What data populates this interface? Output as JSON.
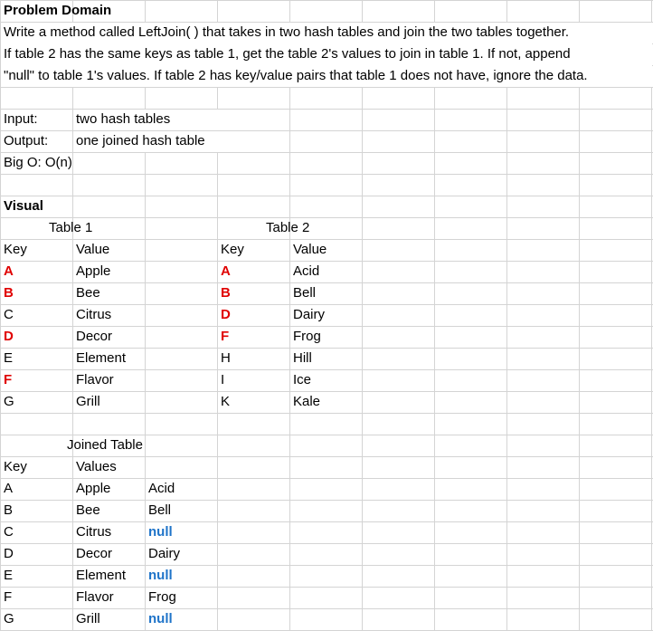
{
  "problem_domain": {
    "heading": "Problem Domain",
    "lines": [
      "Write a method called LeftJoin( ) that takes in two hash tables and join the two tables together.",
      "If table 2 has the same keys as table 1, get the table 2's values to join in table 1. If not, append",
      "\"null\" to table 1's values. If table 2 has key/value pairs that table 1 does not have, ignore the data."
    ]
  },
  "spec": {
    "input_label": "Input:",
    "input_value": "two hash tables",
    "output_label": "Output:",
    "output_value": "one joined hash table",
    "bigo": "Big O: O(n)"
  },
  "visual": {
    "heading": "Visual",
    "table1": {
      "title": "Table 1",
      "key_header": "Key",
      "value_header": "Value",
      "rows": [
        {
          "key": "A",
          "value": "Apple",
          "match": true
        },
        {
          "key": "B",
          "value": "Bee",
          "match": true
        },
        {
          "key": "C",
          "value": "Citrus",
          "match": false
        },
        {
          "key": "D",
          "value": "Decor",
          "match": true
        },
        {
          "key": "E",
          "value": "Element",
          "match": false
        },
        {
          "key": "F",
          "value": "Flavor",
          "match": true
        },
        {
          "key": "G",
          "value": "Grill",
          "match": false
        }
      ]
    },
    "table2": {
      "title": "Table 2",
      "key_header": "Key",
      "value_header": "Value",
      "rows": [
        {
          "key": "A",
          "value": "Acid",
          "match": true
        },
        {
          "key": "B",
          "value": "Bell",
          "match": true
        },
        {
          "key": "D",
          "value": "Dairy",
          "match": true
        },
        {
          "key": "F",
          "value": "Frog",
          "match": true
        },
        {
          "key": "H",
          "value": "Hill",
          "match": false
        },
        {
          "key": "I",
          "value": "Ice",
          "match": false
        },
        {
          "key": "K",
          "value": "Kale",
          "match": false
        }
      ]
    },
    "joined": {
      "title": "Joined Table",
      "key_header": "Key",
      "values_header": "Values",
      "rows": [
        {
          "key": "A",
          "value1": "Apple",
          "value2": "Acid",
          "is_null": false
        },
        {
          "key": "B",
          "value1": "Bee",
          "value2": "Bell",
          "is_null": false
        },
        {
          "key": "C",
          "value1": "Citrus",
          "value2": "null",
          "is_null": true
        },
        {
          "key": "D",
          "value1": "Decor",
          "value2": "Dairy",
          "is_null": false
        },
        {
          "key": "E",
          "value1": "Element",
          "value2": "null",
          "is_null": true
        },
        {
          "key": "F",
          "value1": "Flavor",
          "value2": "Frog",
          "is_null": false
        },
        {
          "key": "G",
          "value1": "Grill",
          "value2": "null",
          "is_null": true
        }
      ]
    }
  },
  "colors": {
    "gridline": "#d4d4d4",
    "match_key": "#e00000",
    "null_value": "#1f74c9"
  }
}
